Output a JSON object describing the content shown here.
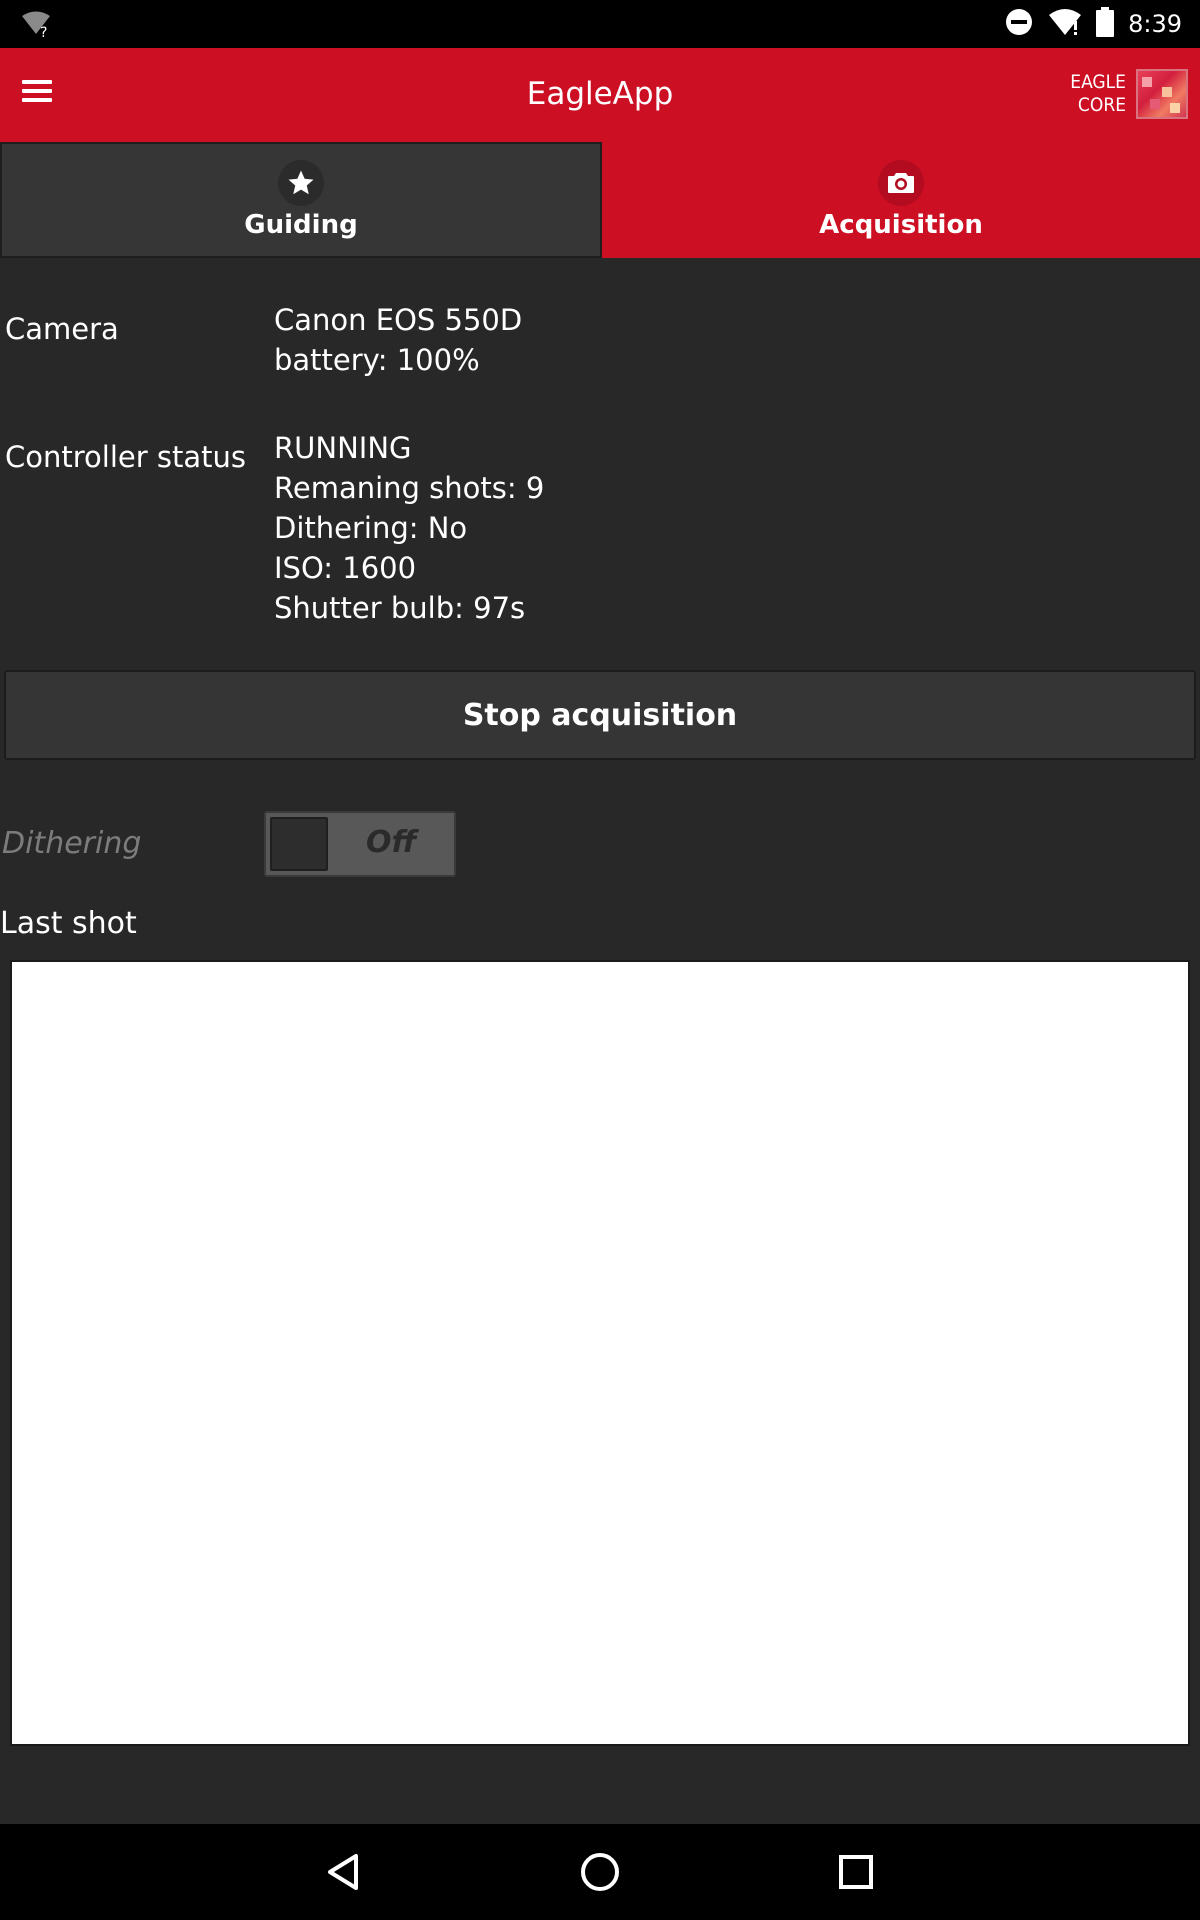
{
  "status_bar": {
    "time": "8:39",
    "icons": [
      "wifi-question-icon",
      "do-not-disturb-icon",
      "wifi-alert-icon",
      "battery-icon"
    ]
  },
  "app_bar": {
    "title": "EagleApp",
    "menu_icon": "hamburger-menu-icon",
    "brand_line1": "EAGLE",
    "brand_line2": "CORE",
    "accent_color": "#cd0f24"
  },
  "tabs": [
    {
      "label": "Guiding",
      "icon": "star-icon",
      "selected": false
    },
    {
      "label": "Acquisition",
      "icon": "camera-icon",
      "selected": true
    }
  ],
  "camera": {
    "label": "Camera",
    "model": "Canon EOS 550D",
    "battery": "battery: 100%"
  },
  "controller": {
    "label": "Controller status",
    "state": "RUNNING",
    "remaining_shots": "Remaning shots: 9",
    "dithering": "Dithering: No",
    "iso": "ISO: 1600",
    "shutter": "Shutter bulb: 97s"
  },
  "actions": {
    "stop_label": "Stop acquisition"
  },
  "dithering_toggle": {
    "label": "Dithering",
    "state_text": "Off",
    "enabled": false
  },
  "last_shot": {
    "label": "Last shot"
  },
  "nav_bar": {
    "icons": [
      "back-icon",
      "home-icon",
      "recents-icon"
    ]
  }
}
